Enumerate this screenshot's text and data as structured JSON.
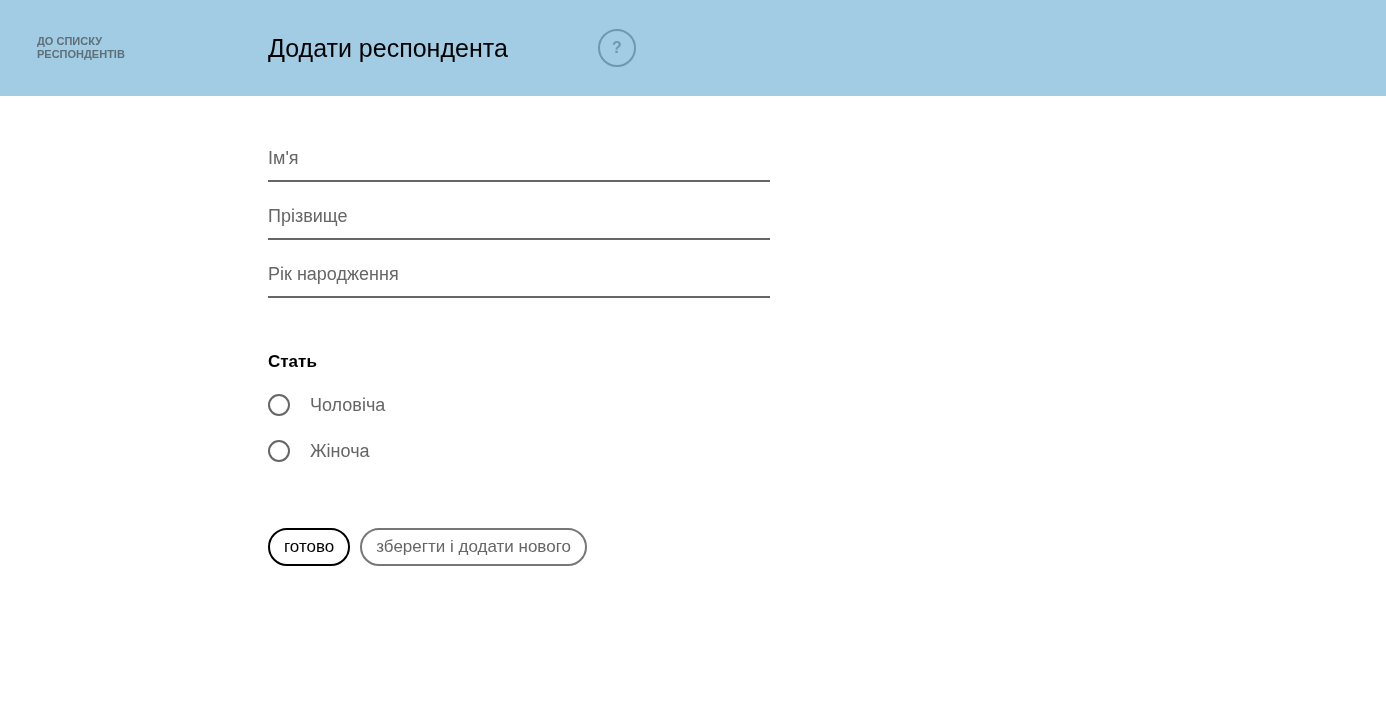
{
  "header": {
    "back_link": "ДО СПИСКУ РЕСПОНДЕНТІВ",
    "title": "Додати респондента",
    "help": "?"
  },
  "fields": [
    {
      "placeholder": "Ім'я"
    },
    {
      "placeholder": "Прізвище"
    },
    {
      "placeholder": "Рік народження"
    }
  ],
  "gender": {
    "label": "Стать",
    "options": [
      {
        "label": "Чоловіча",
        "selected": false
      },
      {
        "label": "Жіноча",
        "selected": false
      }
    ]
  },
  "buttons": [
    {
      "label": "готово",
      "kind": "primary"
    },
    {
      "label": "зберегти і додати нового",
      "kind": "secondary"
    }
  ]
}
